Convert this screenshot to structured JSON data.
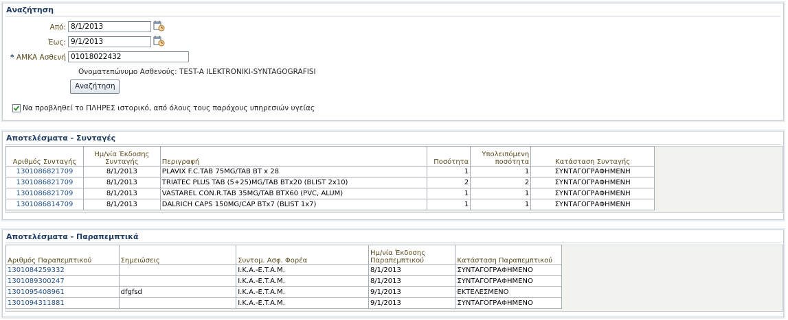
{
  "search": {
    "title": "Αναζήτηση",
    "from_label": "Από:",
    "from_value": "8/1/2013",
    "to_label": "Έως:",
    "to_value": "9/1/2013",
    "amka_required": "*",
    "amka_label": "ΑΜΚΑ Ασθενή",
    "amka_value": "01018022432",
    "patient_name": "Ονοματεπώνυμο Ασθενούς: TEST-A ILEKTRONIKI-SYNTAGOGRAFISI",
    "search_button": "Αναζήτηση",
    "full_history_checked": true,
    "full_history_label": "Να προβληθεί το ΠΛΗΡΕΣ ιστορικό, από όλους τους παρόχους υπηρεσιών υγείας"
  },
  "prescriptions": {
    "title": "Αποτελέσματα - Συνταγές",
    "headers": {
      "number": "Αριθμός Συνταγής",
      "date_line1": "Ημ/νία Έκδοσης",
      "date_line2": "Συνταγής",
      "description": "Περιγραφή",
      "quantity": "Ποσότητα",
      "remaining_line1": "Υπολειπόμενη",
      "remaining_line2": "ποσότητα",
      "status": "Κατάσταση Συνταγής"
    },
    "rows": [
      {
        "number": "1301086821709",
        "date": "8/1/2013",
        "description": "PLAVIX F.C.TAB 75MG/TAB BT x 28",
        "quantity": "1",
        "remaining": "1",
        "status": "ΣΥΝΤΑΓΟΓΡΑΦΗΜΕΝΗ"
      },
      {
        "number": "1301086821709",
        "date": "8/1/2013",
        "description": "TRIATEC PLUS TAB (5+25)MG/TAB BTx20 (BLIST 2x10)",
        "quantity": "2",
        "remaining": "2",
        "status": "ΣΥΝΤΑΓΟΓΡΑΦΗΜΕΝΗ"
      },
      {
        "number": "1301086821709",
        "date": "8/1/2013",
        "description": "VASTAREL CON.R.TAB 35MG/TAB BTX60 (PVC, ALUM)",
        "quantity": "1",
        "remaining": "1",
        "status": "ΣΥΝΤΑΓΟΓΡΑΦΗΜΕΝΗ"
      },
      {
        "number": "1301086814709",
        "date": "8/1/2013",
        "description": "DALRICH CAPS 150MG/CAP BTx7 (BLIST 1x7)",
        "quantity": "1",
        "remaining": "1",
        "status": "ΣΥΝΤΑΓΟΓΡΑΦΗΜΕΝΗ"
      }
    ]
  },
  "referrals": {
    "title": "Αποτελέσματα - Παραπεμπτικά",
    "headers": {
      "number": "Αριθμός Παραπεμπτικού",
      "notes": "Σημειώσεις",
      "insurer": "Συντομ. Ασφ. Φορέα",
      "date_line1": "Ημ/νία Έκδοσης",
      "date_line2": "Παραπεμπτικού",
      "status": "Κατάσταση Παραπεμπτικού"
    },
    "rows": [
      {
        "number": "1301084259332",
        "notes": "",
        "insurer": "I.K.A.-E.T.A.M.",
        "date": "8/1/2013",
        "status": "ΣΥΝΤΑΓΟΓΡΑΦΗΜΕΝΟ"
      },
      {
        "number": "1301089300247",
        "notes": "",
        "insurer": "I.K.A.-E.T.A.M.",
        "date": "8/1/2013",
        "status": "ΣΥΝΤΑΓΟΓΡΑΦΗΜΕΝΟ"
      },
      {
        "number": "1301095408961",
        "notes": "dfgfsd",
        "insurer": "I.K.A.-E.T.A.M.",
        "date": "9/1/2013",
        "status": "ΕΚΤΕΛΕΣΜΕΝΟ"
      },
      {
        "number": "1301094311881",
        "notes": "",
        "insurer": "I.K.A.-E.T.A.M.",
        "date": "9/1/2013",
        "status": "ΣΥΝΤΑΓΟΓΡΑΦΗΜΕΝΟ"
      }
    ]
  }
}
